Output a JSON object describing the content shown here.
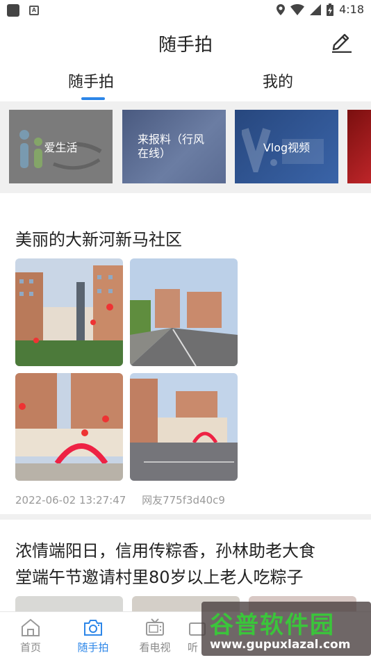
{
  "status_bar": {
    "time": "4:18",
    "battery_glyph": "battery-charging-icon",
    "notif_letter": "A"
  },
  "header": {
    "title": "随手拍",
    "edit_icon": "pencil-icon"
  },
  "tabs": [
    {
      "label": "随手拍",
      "active": true
    },
    {
      "label": "我的",
      "active": false
    }
  ],
  "categories": [
    {
      "label": "爱生活"
    },
    {
      "label": "来报料（行风在线）"
    },
    {
      "label": "Vlog视频"
    },
    {
      "label": ""
    }
  ],
  "posts": [
    {
      "title": "美丽的大新河新马社区",
      "timestamp": "2022-06-02 13:27:47",
      "author": "网友775f3d40c9",
      "photo_count": 4
    },
    {
      "title_line1": "浓情端阳日，信用传粽香，孙林助老大食",
      "title_line2": "堂端午节邀请村里80岁以上老人吃粽子"
    }
  ],
  "bottom_nav": [
    {
      "label": "首页",
      "icon": "home-icon",
      "active": false
    },
    {
      "label": "随手拍",
      "icon": "camera-icon",
      "active": true
    },
    {
      "label": "看电视",
      "icon": "tv-icon",
      "active": false
    },
    {
      "label": "听",
      "icon": "radio-icon",
      "active": false
    }
  ],
  "watermark": {
    "brand": "谷普软件园",
    "url": "www.gupuxlazal.com"
  },
  "colors": {
    "accent": "#2c86e8",
    "muted_text": "#999999",
    "section_bg": "#f0f0f0"
  }
}
